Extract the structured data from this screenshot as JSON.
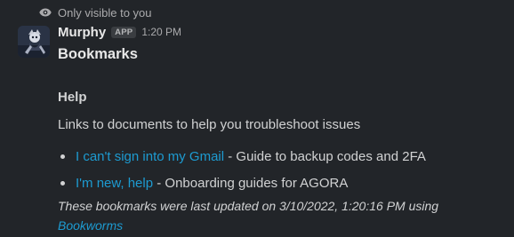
{
  "visibility": {
    "icon": "eye-icon",
    "text": "Only visible to you"
  },
  "message": {
    "avatar_icon": "bot-avatar",
    "sender": "Murphy",
    "badge": "APP",
    "time": "1:20 PM",
    "title": "Bookmarks",
    "section": "Help",
    "description": "Links to documents to help you troubleshoot issues",
    "bookmarks": [
      {
        "link": "I can't sign into my Gmail",
        "desc": " - Guide to backup codes and 2FA"
      },
      {
        "link": "I'm new, help",
        "desc": " - Onboarding guides for AGORA"
      }
    ],
    "footer_text": "These bookmarks were last updated on 3/10/2022, 1:20:16 PM using",
    "footer_link": "Bookworms"
  },
  "colors": {
    "background": "#222529",
    "link": "#1d9bd1",
    "text": "#d1d2d3"
  }
}
